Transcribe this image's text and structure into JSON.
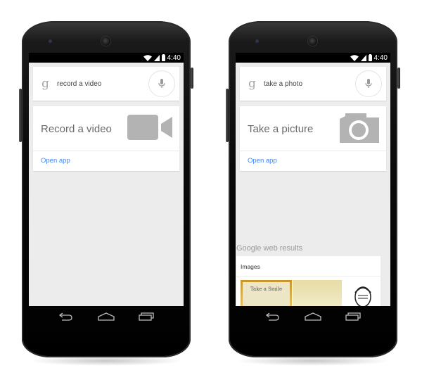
{
  "phones": [
    {
      "status": {
        "time": "4:40"
      },
      "search": {
        "query": "record a video",
        "logo": "g"
      },
      "action": {
        "title": "Record a video",
        "icon": "video-camera-icon",
        "link": "Open app"
      }
    },
    {
      "status": {
        "time": "4:40"
      },
      "search": {
        "query": "take a photo",
        "logo": "g"
      },
      "action": {
        "title": "Take a picture",
        "icon": "photo-camera-icon",
        "link": "Open app"
      },
      "web_results": {
        "title": "Google web results",
        "images_label": "Images",
        "thumb_caption": "Take a Smile"
      }
    }
  ],
  "colors": {
    "link": "#4285f4",
    "card_icon": "#b3b3b3",
    "screen_bg": "#ececec"
  }
}
